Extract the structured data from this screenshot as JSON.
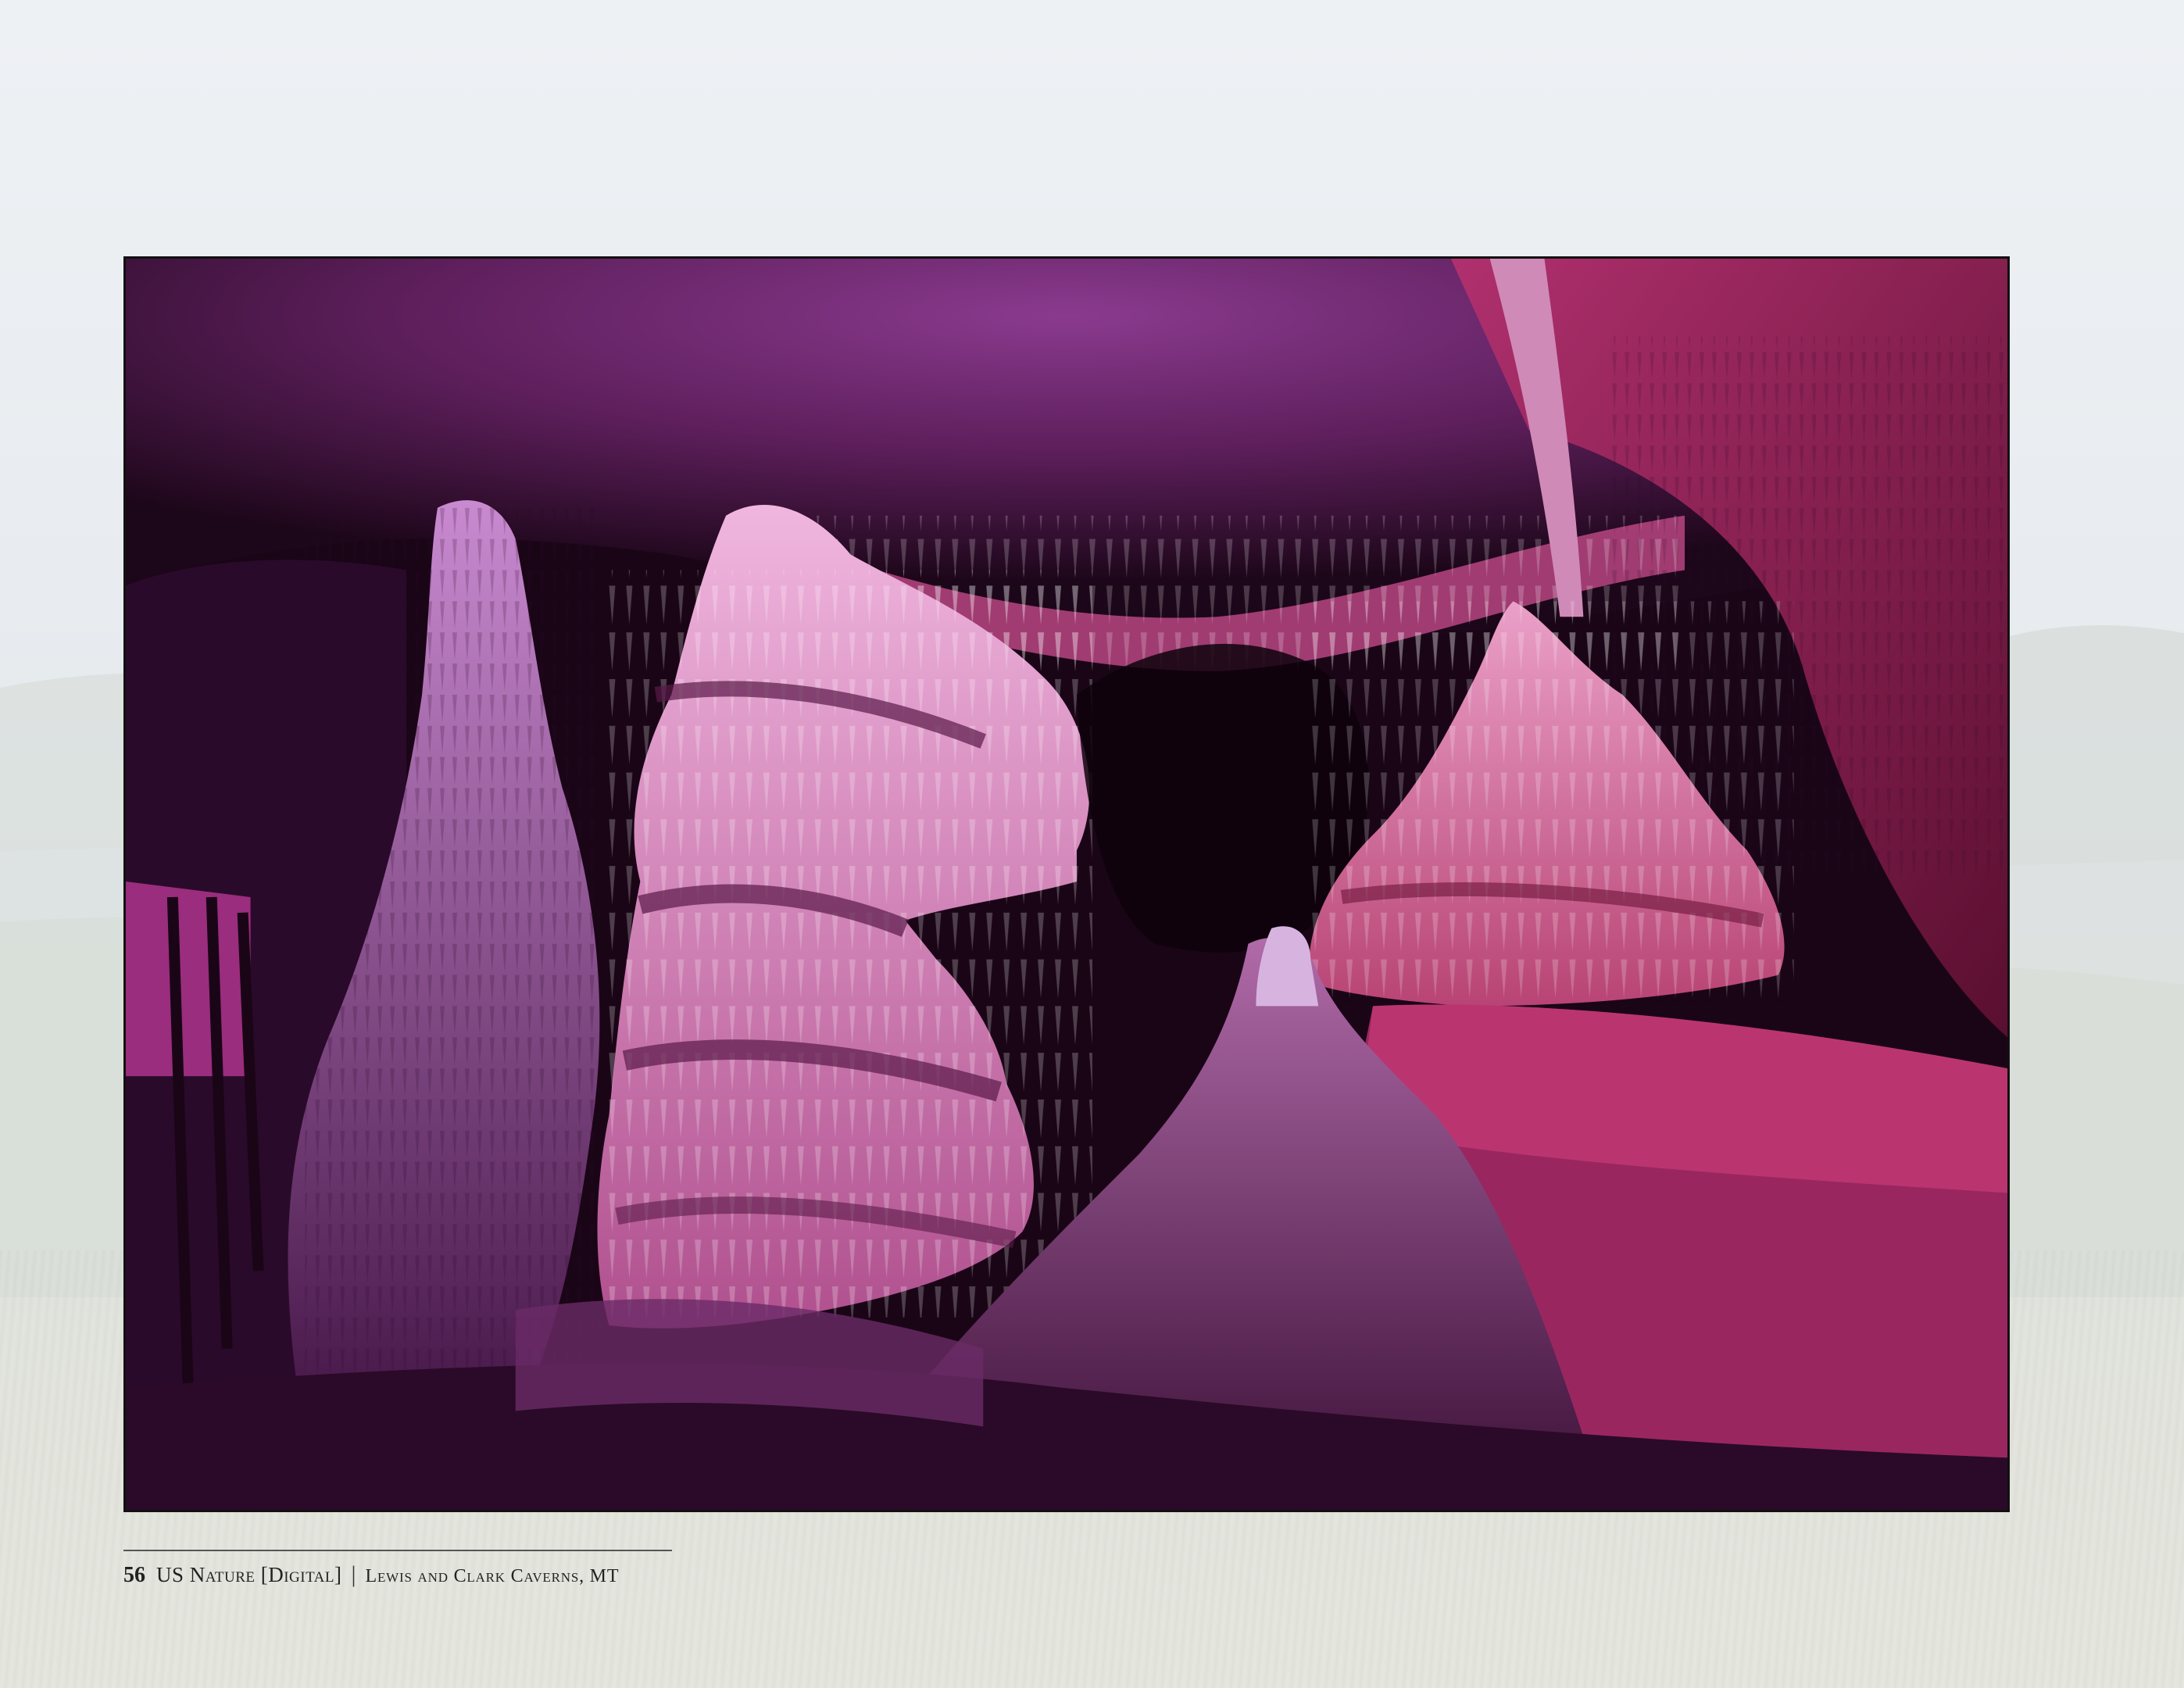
{
  "footer": {
    "page_number": "56",
    "publication": "US Nature [Digital]",
    "separator": "|",
    "location": "Lewis and Clark Caverns, MT"
  },
  "photo": {
    "subject": "cave-formations-photo",
    "accent_colors": [
      "#c23a8a",
      "#e89ac8",
      "#5a1a5a",
      "#2a0a28"
    ]
  }
}
